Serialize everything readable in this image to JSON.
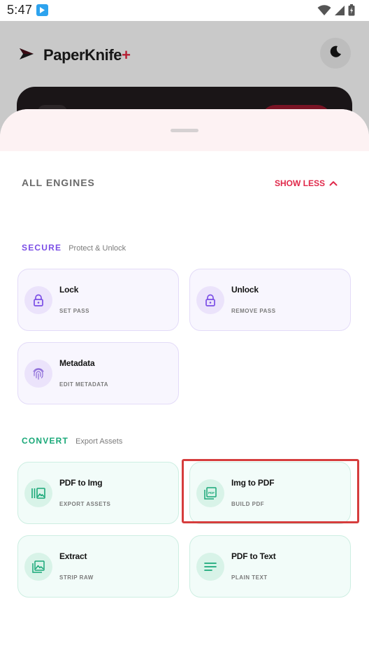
{
  "status_bar": {
    "time": "5:47"
  },
  "app": {
    "name": "PaperKnife",
    "name_suffix": "+"
  },
  "sheet": {
    "heading": "ALL ENGINES",
    "toggle_label": "SHOW LESS",
    "sections": {
      "secure": {
        "title": "SECURE",
        "subtitle": "Protect & Unlock",
        "color": "#7b4ee6",
        "tools": [
          {
            "title": "Lock",
            "subtitle": "SET PASS",
            "icon": "lock-icon"
          },
          {
            "title": "Unlock",
            "subtitle": "REMOVE PASS",
            "icon": "unlock-icon"
          },
          {
            "title": "Metadata",
            "subtitle": "EDIT METADATA",
            "icon": "fingerprint-icon"
          }
        ]
      },
      "convert": {
        "title": "CONVERT",
        "subtitle": "Export Assets",
        "color": "#19a878",
        "tools": [
          {
            "title": "PDF to Img",
            "subtitle": "EXPORT ASSETS",
            "icon": "images-icon"
          },
          {
            "title": "Img to PDF",
            "subtitle": "BUILD PDF",
            "icon": "pdf-stack-icon"
          },
          {
            "title": "Extract",
            "subtitle": "STRIP RAW",
            "icon": "image-icon"
          },
          {
            "title": "PDF to Text",
            "subtitle": "PLAIN TEXT",
            "icon": "text-lines-icon"
          }
        ]
      }
    }
  },
  "colors": {
    "accent": "#e0284a",
    "secure": "#7b4ee6",
    "convert": "#19a878",
    "highlight": "#d63d3d"
  }
}
